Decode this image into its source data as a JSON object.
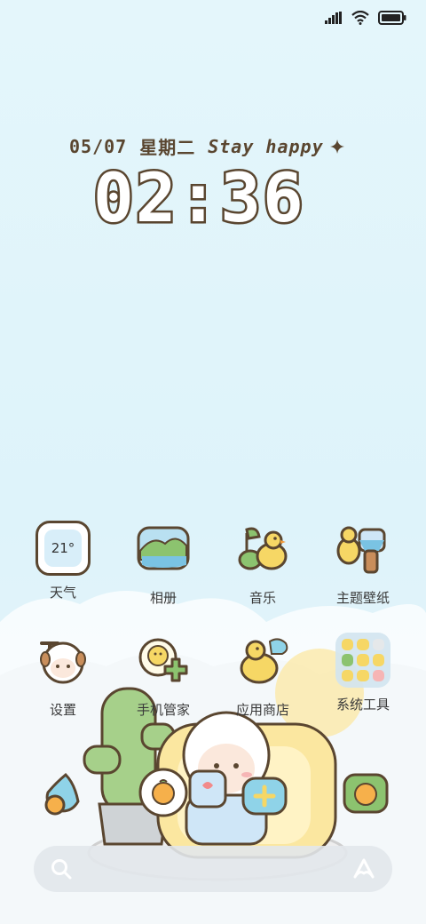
{
  "status_bar": {
    "icons": [
      "signal-icon",
      "wifi-icon",
      "battery-icon"
    ]
  },
  "lock_widget": {
    "date": "05/07",
    "weekday": "星期二",
    "message": "Stay happy",
    "time": "02:36"
  },
  "apps": [
    {
      "label": "天气",
      "icon": "weather-icon",
      "temp": "21°"
    },
    {
      "label": "相册",
      "icon": "gallery-icon"
    },
    {
      "label": "音乐",
      "icon": "music-icon"
    },
    {
      "label": "主题壁纸",
      "icon": "theme-icon"
    },
    {
      "label": "设置",
      "icon": "settings-icon"
    },
    {
      "label": "手机管家",
      "icon": "security-icon"
    },
    {
      "label": "应用商店",
      "icon": "app-store-icon"
    },
    {
      "label": "系统工具",
      "icon": "tools-folder-icon"
    }
  ],
  "dock": [
    "phone-icon",
    "messages-icon",
    "camera-icon",
    "browser-icon",
    "gallery-dock-icon"
  ],
  "search": {
    "icon": "search-icon",
    "assistant_icon": "assistant-icon"
  },
  "colors": {
    "outline": "#5a4630",
    "sky": "#e4f6fb",
    "yellow": "#f6d765",
    "green": "#8cc36f"
  }
}
